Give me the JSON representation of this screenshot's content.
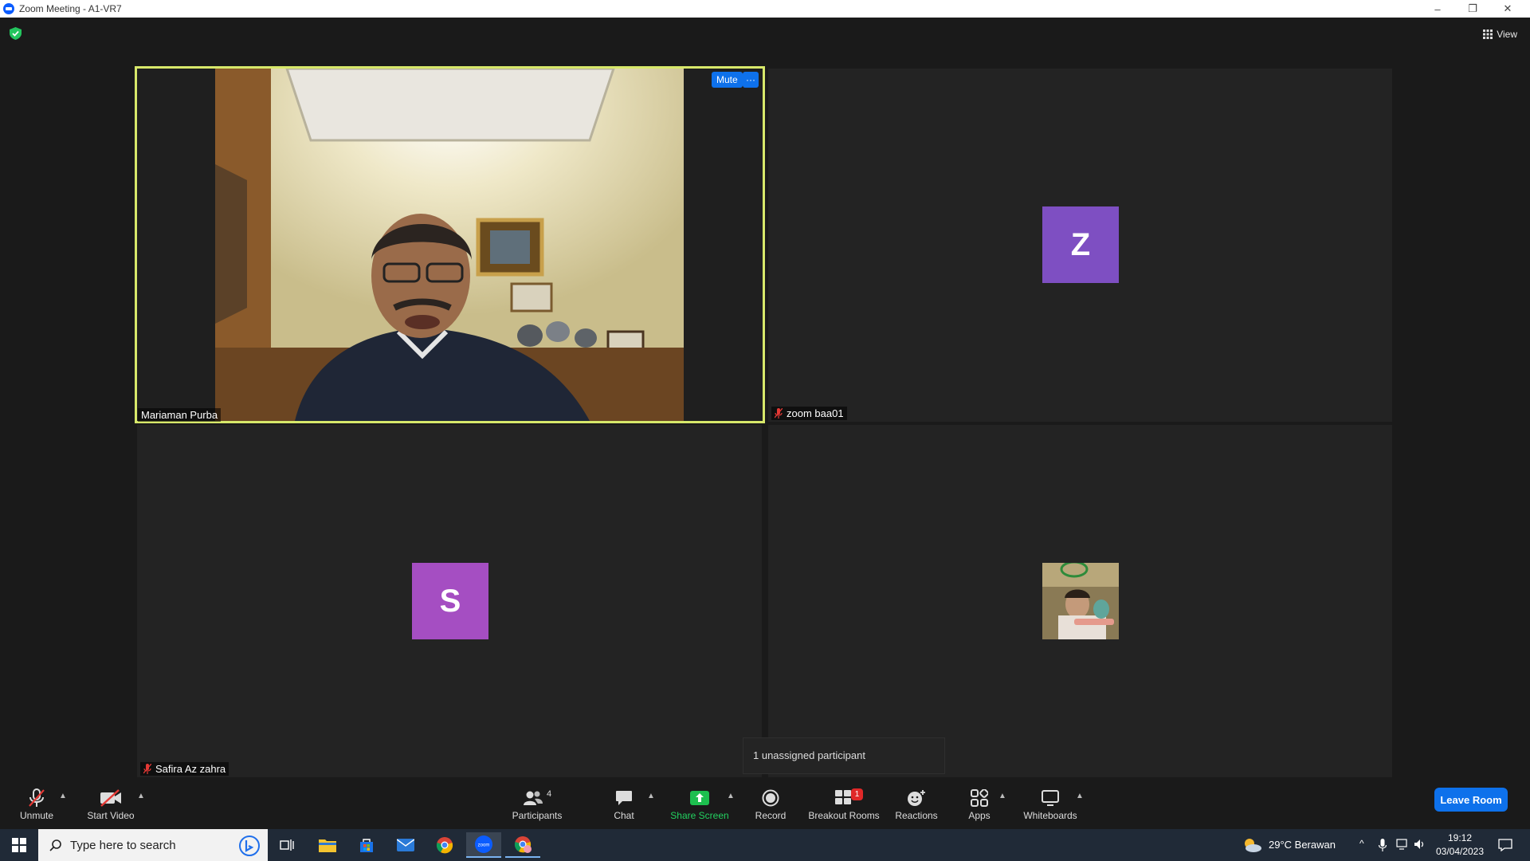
{
  "window": {
    "title": "Zoom Meeting - A1-VR7"
  },
  "top": {
    "view_label": "View"
  },
  "tiles": {
    "t1": {
      "name": "Mariaman Purba",
      "mute_label": "Mute",
      "more_label": "···"
    },
    "t2": {
      "name": "zoom baa01",
      "initial": "Z",
      "color": "#7e4fc2"
    },
    "t3": {
      "name": "Safira Az zahra",
      "initial": "S",
      "color": "#a54ec2"
    },
    "t4": {
      "name": ""
    }
  },
  "tooltip": "1 unassigned participant",
  "toolbar": {
    "unmute": "Unmute",
    "start_video": "Start Video",
    "participants": "Participants",
    "participants_count": "4",
    "chat": "Chat",
    "share_screen": "Share Screen",
    "record": "Record",
    "breakout_rooms": "Breakout Rooms",
    "breakout_badge": "1",
    "reactions": "Reactions",
    "apps": "Apps",
    "whiteboards": "Whiteboards",
    "leave": "Leave Room"
  },
  "taskbar": {
    "search_placeholder": "Type here to search",
    "weather": "29°C  Berawan",
    "time": "19:12",
    "date": "03/04/2023"
  },
  "colors": {
    "accent": "#0e71eb",
    "share_green": "#1dbf4f",
    "active_border": "#d7e86a"
  }
}
